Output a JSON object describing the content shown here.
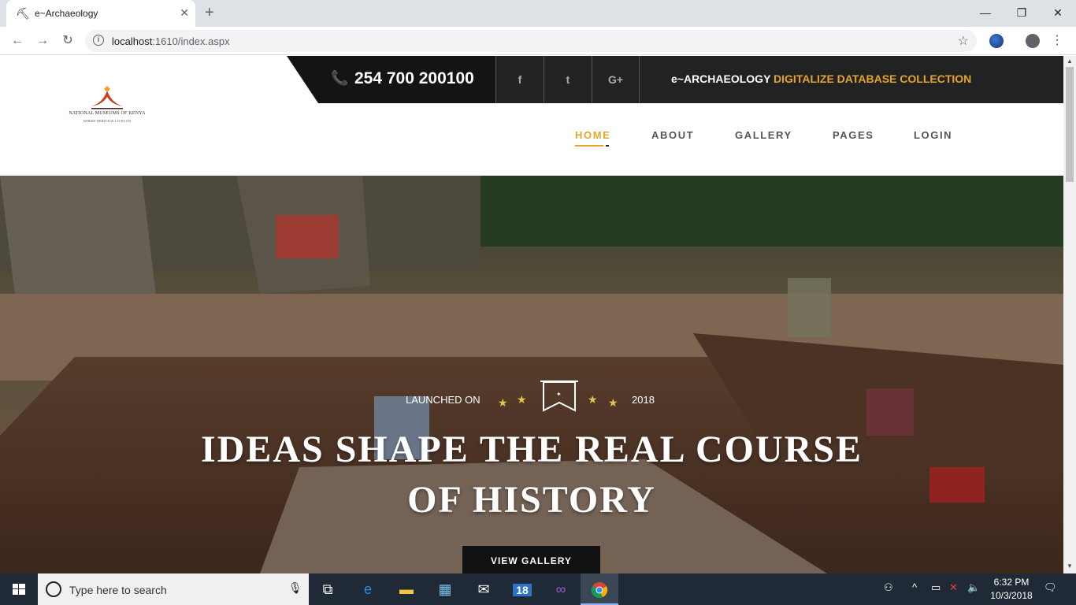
{
  "browser": {
    "tab_title": "e~Archaeology",
    "url_host": "localhost",
    "url_rest": ":1610/index.aspx",
    "new_tab": "+",
    "close_tab": "✕"
  },
  "logo": {
    "line1": "NATIONAL MUSEUMS OF KENYA",
    "line2": "WHERE HERITAGE LIVES ON"
  },
  "topbar": {
    "phone": "254 700 200100",
    "social": [
      "f",
      "t",
      "G+"
    ],
    "tagline_main": "e~ARCHAEOLOGY ",
    "tagline_accent": "DIGITALIZE DATABASE COLLECTION"
  },
  "nav": {
    "items": [
      "HOME",
      "ABOUT",
      "GALLERY",
      "PAGES",
      "LOGIN"
    ],
    "active": "HOME"
  },
  "hero": {
    "launched": "LAUNCHED ON",
    "year": "2018",
    "headline_line1": "IDEAS SHAPE THE REAL COURSE",
    "headline_line2": "OF HISTORY",
    "cta": "VIEW GALLERY"
  },
  "taskbar": {
    "search_placeholder": "Type here to search",
    "time": "6:32 PM",
    "date": "10/3/2018",
    "calendar_badge": "18"
  },
  "colors": {
    "accent": "#e6a52a",
    "dark_bar": "#222222",
    "taskbar": "#1f2a36"
  }
}
